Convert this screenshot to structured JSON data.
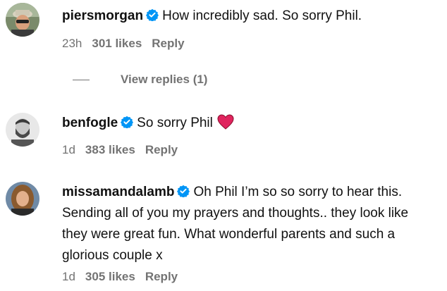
{
  "comments": [
    {
      "username": "piersmorgan",
      "text": "How incredibly sad. So sorry Phil.",
      "time": "23h",
      "likes": "301 likes",
      "reply": "Reply",
      "view_replies": "View replies (1)"
    },
    {
      "username": "benfogle",
      "text": "So sorry Phil",
      "time": "1d",
      "likes": "383 likes",
      "reply": "Reply"
    },
    {
      "username": "missamandalamb",
      "text_lines": [
        "Oh Phil I’m so so sorry to hear this.",
        "Sending all of you my prayers and thoughts.. they look like",
        "they were great fun. What wonderful parents and such a",
        "glorious couple x"
      ],
      "time": "1d",
      "likes": "305 likes",
      "reply": "Reply"
    }
  ],
  "colors": {
    "text": "#111111",
    "meta": "#737373",
    "verified": "#0095f6",
    "heart": "#e0245e"
  },
  "icons": [
    "verified-badge-icon",
    "red-heart-icon"
  ]
}
